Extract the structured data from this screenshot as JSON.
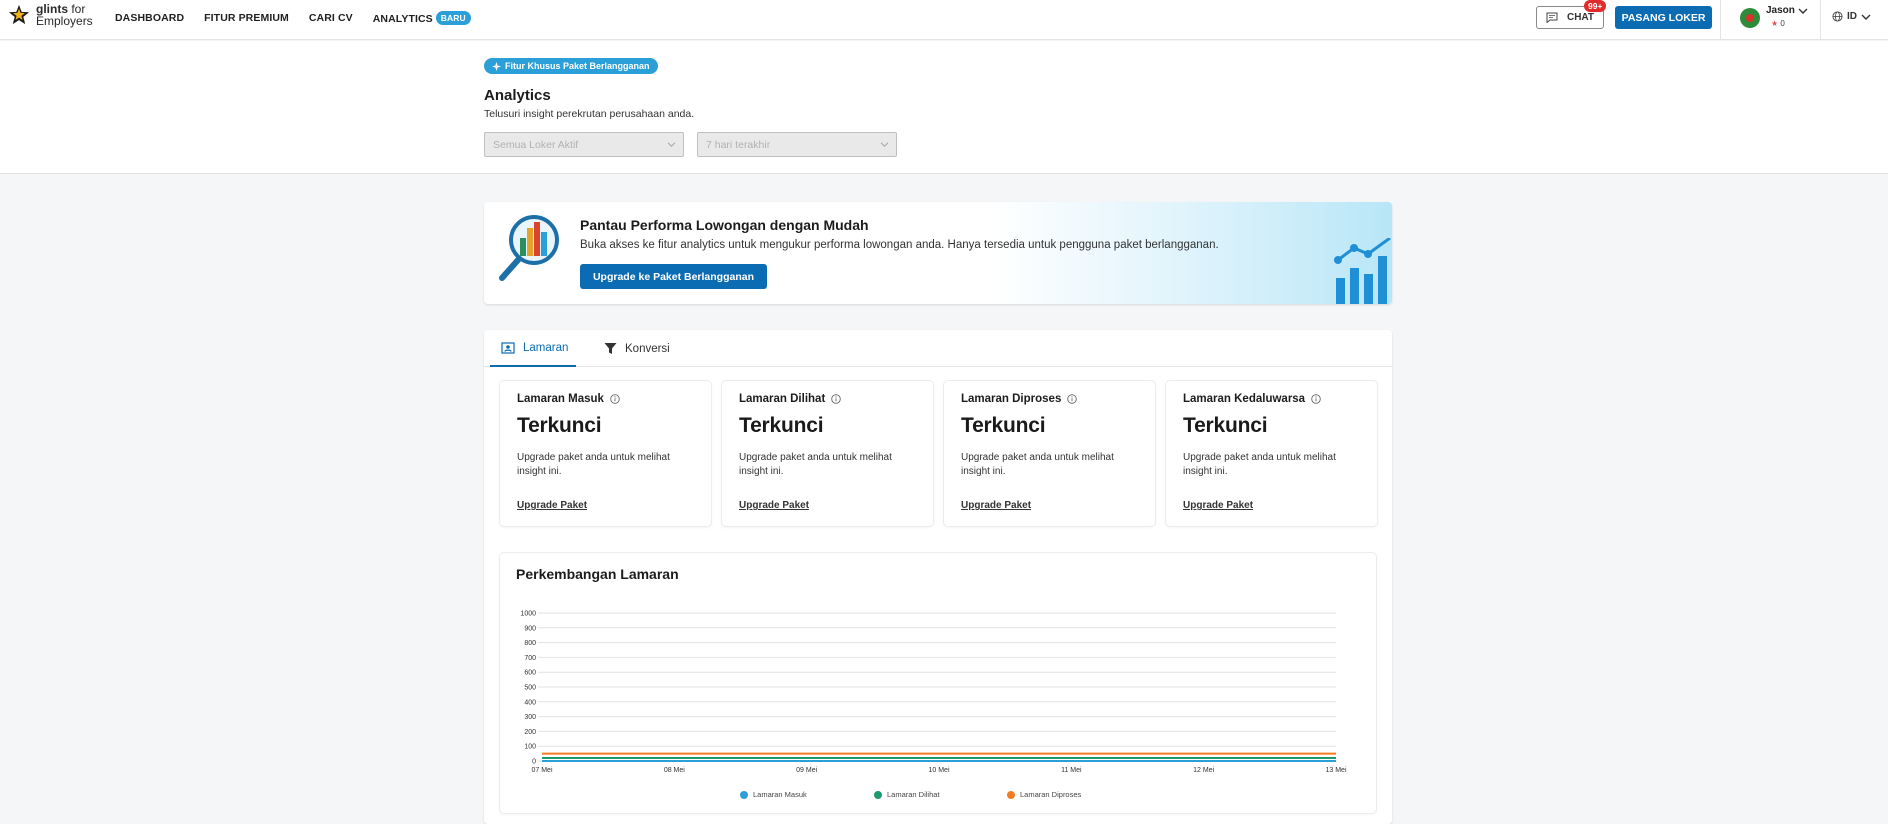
{
  "nav": {
    "logo_brand": "glints",
    "logo_for": "for",
    "logo_employers": "Employers",
    "links": [
      "DASHBOARD",
      "FITUR PREMIUM",
      "CARI CV",
      "ANALYTICS"
    ],
    "analytics_badge": "BARU",
    "chat_label": "CHAT",
    "chat_count": "99+",
    "post_button": "PASANG LOKER",
    "user_name": "Jason",
    "user_points": "0",
    "language": "ID"
  },
  "header": {
    "feature_chip": "Fitur Khusus Paket Berlangganan",
    "title": "Analytics",
    "subtitle": "Telusuri insight perekrutan perusahaan anda.",
    "job_select_placeholder": "Semua Loker Aktif",
    "range_select_placeholder": "7 hari terakhir"
  },
  "banner": {
    "title": "Pantau Performa Lowongan dengan Mudah",
    "description": "Buka akses ke fitur analytics untuk mengukur performa lowongan anda. Hanya tersedia untuk pengguna paket berlangganan.",
    "button": "Upgrade ke Paket Berlangganan"
  },
  "tabs": [
    {
      "label": "Lamaran",
      "active": true
    },
    {
      "label": "Konversi",
      "active": false
    }
  ],
  "stats": [
    {
      "label": "Lamaran Masuk",
      "value": "Terkunci",
      "desc": "Upgrade paket anda untuk melihat insight ini.",
      "link": "Upgrade Paket"
    },
    {
      "label": "Lamaran Dilihat",
      "value": "Terkunci",
      "desc": "Upgrade paket anda untuk melihat insight ini.",
      "link": "Upgrade Paket"
    },
    {
      "label": "Lamaran Diproses",
      "value": "Terkunci",
      "desc": "Upgrade paket anda untuk melihat insight ini.",
      "link": "Upgrade Paket"
    },
    {
      "label": "Lamaran Kedaluwarsa",
      "value": "Terkunci",
      "desc": "Upgrade paket anda untuk melihat insight ini.",
      "link": "Upgrade Paket"
    }
  ],
  "colors": {
    "primary": "#0b6cb3",
    "accent": "#2a9fd8",
    "series_masuk": "#2a9fd8",
    "series_dilihat": "#1c9a6c",
    "series_diproses": "#f47b20"
  },
  "chart_data": {
    "type": "line",
    "title": "Perkembangan Lamaran",
    "x": [
      "07 Mei",
      "08 Mei",
      "09 Mei",
      "10 Mei",
      "11 Mei",
      "12 Mei",
      "13 Mei"
    ],
    "yticks": [
      0,
      100,
      200,
      300,
      400,
      500,
      600,
      700,
      800,
      900,
      1000
    ],
    "ylim": [
      0,
      1000
    ],
    "grid": true,
    "legend_position": "bottom",
    "series": [
      {
        "name": "Lamaran Masuk",
        "color": "#2a9fd8",
        "values": [
          0,
          0,
          0,
          0,
          0,
          0,
          0
        ]
      },
      {
        "name": "Lamaran Dilihat",
        "color": "#1c9a6c",
        "values": [
          20,
          20,
          20,
          20,
          20,
          20,
          20
        ]
      },
      {
        "name": "Lamaran Diproses",
        "color": "#f47b20",
        "values": [
          50,
          50,
          50,
          50,
          50,
          50,
          50
        ]
      }
    ]
  }
}
